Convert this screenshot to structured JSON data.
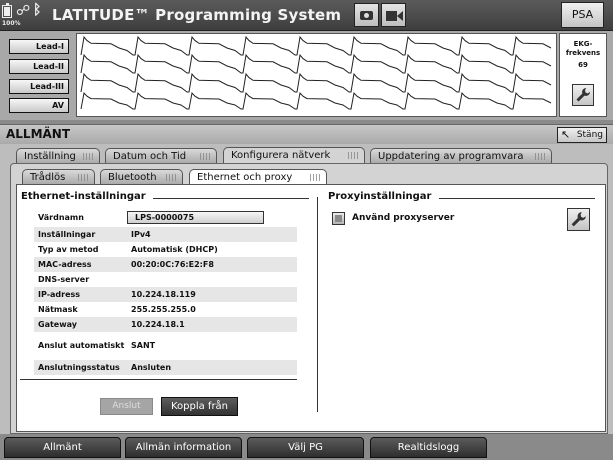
{
  "header": {
    "battery_pct": "100%",
    "app_title": "LATITUDE™ Programming System",
    "psa_label": "PSA",
    "camera_icon": "camera-icon",
    "video_icon": "video-camera-icon"
  },
  "ecg": {
    "lead_buttons": [
      "Lead-I",
      "Lead-II",
      "Lead-III",
      "AV"
    ],
    "hr_label": "EKG-frekvens",
    "hr_value": "69",
    "hr_button_icon": "wrench-icon"
  },
  "window": {
    "title": "ALLMÄNT",
    "close_label": "Stäng"
  },
  "tabs": [
    {
      "label": "Inställning",
      "active": false
    },
    {
      "label": "Datum och Tid",
      "active": false
    },
    {
      "label": "Konfigurera nätverk",
      "active": true
    },
    {
      "label": "Uppdatering av programvara",
      "active": false
    }
  ],
  "subtabs": [
    {
      "label": "Trådlös",
      "active": false
    },
    {
      "label": "Bluetooth",
      "active": false
    },
    {
      "label": "Ethernet och proxy",
      "active": true
    }
  ],
  "ethernet": {
    "title": "Ethernet-inställningar",
    "hostname_label": "Värdnamn",
    "hostname_value": "LPS-0000075",
    "rows": [
      {
        "label": "Inställningar",
        "value": "IPv4"
      },
      {
        "label": "Typ av metod",
        "value": "Automatisk (DHCP)"
      },
      {
        "label": "MAC-adress",
        "value": "00:20:0C:76:E2:F8"
      },
      {
        "label": "DNS-server",
        "value": ""
      },
      {
        "label": "IP-adress",
        "value": "10.224.18.119"
      },
      {
        "label": "Nätmask",
        "value": "255.255.255.0"
      },
      {
        "label": "Gateway",
        "value": "10.224.18.1"
      }
    ],
    "auto_connect_label": "Anslut automatiskt",
    "auto_connect_value": "SANT",
    "status_label": "Anslutningsstatus",
    "status_value": "Ansluten",
    "connect_label": "Anslut",
    "disconnect_label": "Koppla från"
  },
  "proxy": {
    "title": "Proxyinställningar",
    "use_proxy_label": "Använd proxyserver",
    "use_proxy_checked": false,
    "settings_icon": "wrench-icon"
  },
  "bottom_nav": [
    "Allmänt",
    "Allmän information",
    "Välj PG",
    "Realtidslogg"
  ]
}
